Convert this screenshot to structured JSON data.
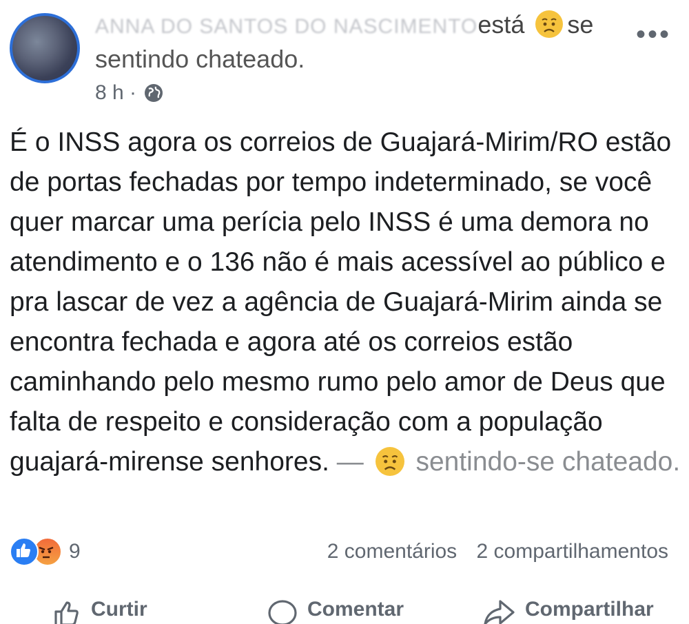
{
  "post": {
    "author_blurred": "ANNA DO SANTOS DO NASCIMENTO",
    "status_verb": "está",
    "status_feeling_word": "se",
    "status_line2": "sentindo chateado.",
    "time": "8 h ·",
    "body": "É o INSS agora os correios de Guajará-Mirim/RO estão de portas fechadas por tempo indeterminado, se você quer marcar uma perícia pelo INSS é uma demora no atendimento e o 136 não é mais acessível ao público e pra lascar de vez a agência de Guajará-Mirim ainda se encontra fechada e agora até os correios estão caminhando pelo mesmo rumo pelo amor de Deus que falta de respeito e consideração com a população guajará-mirense senhores.",
    "feeling_prefix": "—",
    "feeling_text": "sentindo-se chateado."
  },
  "reactions": {
    "count": "9",
    "icons": [
      "like-icon",
      "angry-icon"
    ]
  },
  "stats": {
    "comments": "2 comentários",
    "shares": "2 compartilhamentos"
  },
  "actions": {
    "like": "Curtir",
    "comment": "Comentar",
    "share": "Compartilhar"
  },
  "colors": {
    "accent": "#2a7ef3",
    "muted": "#606770",
    "emoji": "#f6c33d"
  }
}
